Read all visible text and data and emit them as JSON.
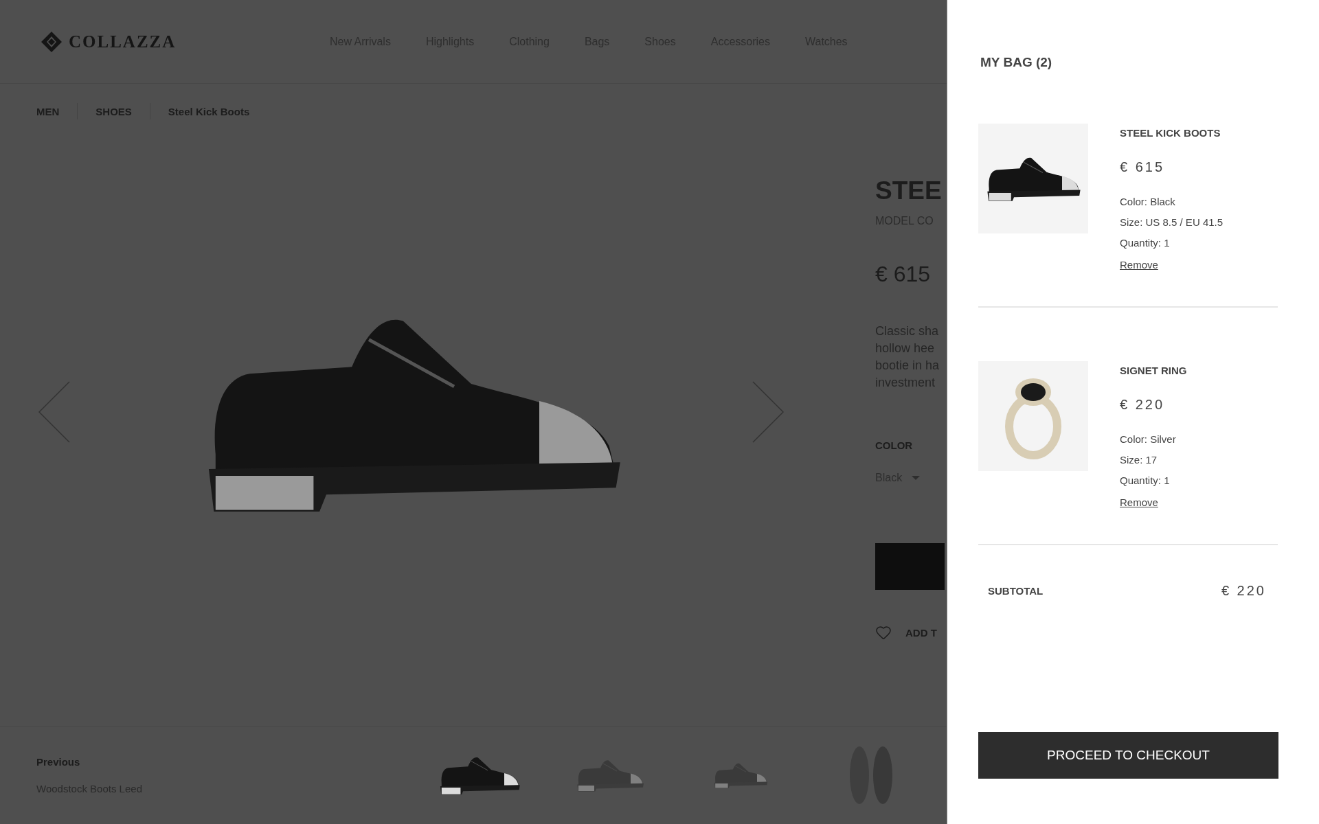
{
  "header": {
    "logo": "COLLAZZA",
    "nav": [
      "New Arrivals",
      "Highlights",
      "Clothing",
      "Bags",
      "Shoes",
      "Accessories",
      "Watches"
    ]
  },
  "breadcrumb": [
    "MEN",
    "SHOES",
    "Steel Kick Boots"
  ],
  "product": {
    "title": "STEE",
    "model_code": "MODEL CO",
    "price": "€ 615",
    "description": [
      "Classic sha",
      "hollow hee",
      "bootie in ha",
      "investment"
    ],
    "color_label": "COLOR",
    "color_value": "Black",
    "wishlist": "ADD T"
  },
  "footer": {
    "previous_label": "Previous",
    "previous_name": "Woodstock Boots Leed",
    "thumbnails": [
      {
        "kind": "side",
        "selected": true
      },
      {
        "kind": "angle",
        "selected": false
      },
      {
        "kind": "back",
        "selected": false
      },
      {
        "kind": "sole",
        "selected": false
      }
    ]
  },
  "bag": {
    "title": "MY BAG (2)",
    "items": [
      {
        "kind": "shoe",
        "name": "STEEL KICK BOOTS",
        "price": "€ 615",
        "details": [
          "Color: Black",
          "Size: US 8.5 / EU 41.5",
          "Quantity: 1"
        ],
        "remove": "Remove"
      },
      {
        "kind": "ring",
        "name": "SIGNET RING",
        "price": "€ 220",
        "details": [
          "Color: Silver",
          "Size: 17",
          "Quantity: 1"
        ],
        "remove": "Remove"
      }
    ],
    "subtotal_label": "SUBTOTAL",
    "subtotal": "€ 220",
    "checkout": "PROCEED TO CHECKOUT"
  }
}
